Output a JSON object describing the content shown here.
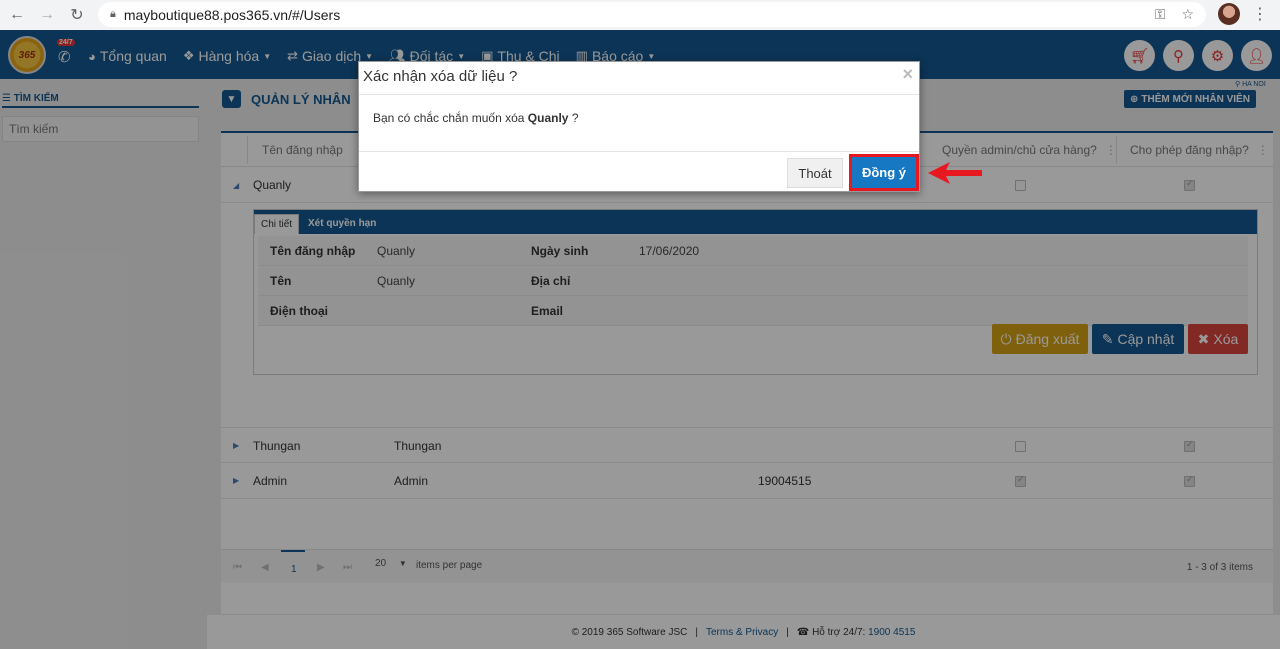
{
  "browser": {
    "url": "mayboutique88.pos365.vn/#/Users"
  },
  "header": {
    "logo": "365",
    "badge": "24/7",
    "menu": [
      "Tổng quan",
      "Hàng hóa",
      "Giao dịch",
      "Đối tác",
      "Thu & Chi",
      "Báo cáo"
    ],
    "location": "HA NOI"
  },
  "sidebar": {
    "title": "TÌM KIẾM",
    "search_placeholder": "Tìm kiếm"
  },
  "main": {
    "page_title": "QUẢN LÝ NHÂN",
    "add_button": "THÊM MỚI NHÂN VIÊN",
    "columns": {
      "username": "Tên đăng nhập",
      "admin": "Quyền admin/chủ cửa hàng?",
      "login": "Cho phép đăng nhập?"
    },
    "rows": [
      {
        "username": "Quanly",
        "name": "",
        "phone": "",
        "admin": false,
        "login": true
      },
      {
        "username": "Thungan",
        "name": "Thungan",
        "phone": "",
        "admin": false,
        "login": true
      },
      {
        "username": "Admin",
        "name": "Admin",
        "phone": "19004515",
        "admin": true,
        "login": true
      }
    ],
    "detail": {
      "tab_details": "Chi tiết",
      "tab_permissions": "Xét quyền hạn",
      "label_username": "Tên đăng nhập",
      "value_username": "Quanly",
      "label_birthday": "Ngày sinh",
      "value_birthday": "17/06/2020",
      "label_name": "Tên",
      "value_name": "Quanly",
      "label_address": "Địa chỉ",
      "label_phone": "Điện thoại",
      "label_email": "Email",
      "btn_logout": "Đăng xuất",
      "btn_update": "Cập nhật",
      "btn_delete": "Xóa"
    },
    "pager": {
      "current_page": "1",
      "page_size": "20",
      "items_label": "items per page",
      "summary": "1 - 3 of 3 items"
    }
  },
  "footer": {
    "copyright": "© 2019 365 Software JSC",
    "terms": "Terms & Privacy",
    "support_label": "Hỗ trợ 24/7:",
    "support_phone": "1900 4515"
  },
  "modal": {
    "title": "Xác nhận xóa dữ liệu ?",
    "body_prefix": "Bạn có chắc chắn muốn xóa",
    "body_name": "Quanly",
    "body_suffix": "?",
    "cancel": "Thoát",
    "confirm": "Đồng ý",
    "close_glyph": "×"
  },
  "colors": {
    "primary": "#15588f",
    "confirm": "#1677c3",
    "highlight": "#e81820",
    "warning": "#d4a017",
    "danger": "#d9453e"
  }
}
